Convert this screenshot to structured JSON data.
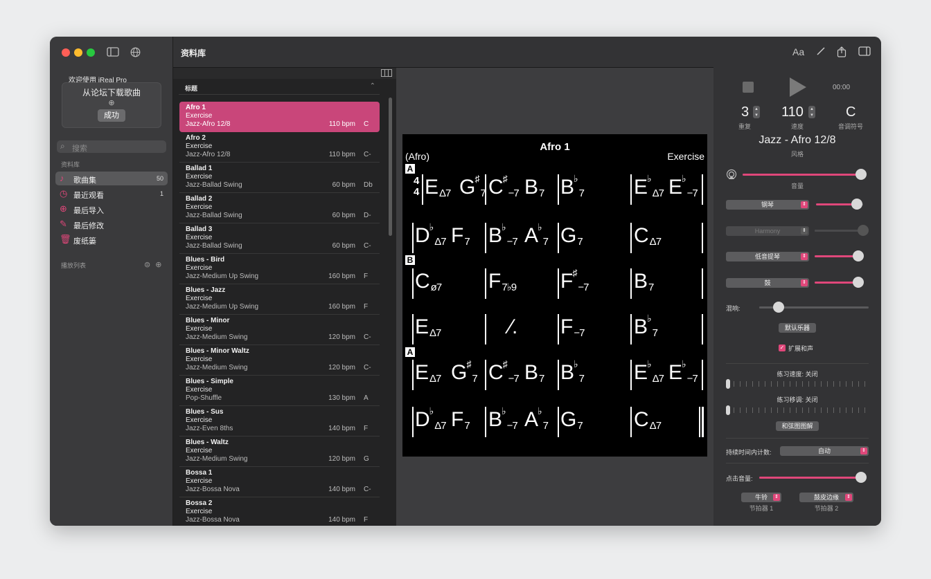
{
  "colors": {
    "accent": "#e0477a",
    "selected_row": "#c9467a",
    "red": "#fe5f57",
    "yellow": "#febc2e",
    "green": "#28c840"
  },
  "sidebar": {
    "welcome": "欢迎使用 iReal Pro",
    "forum_title": "从论坛下载歌曲",
    "forum_button": "成功",
    "search_placeholder": "搜索",
    "library_section": "资料库",
    "items": [
      {
        "icon": "music-note-icon",
        "label": "歌曲集",
        "count": "50"
      },
      {
        "icon": "clock-icon",
        "label": "最近观看",
        "count": "1"
      },
      {
        "icon": "download-icon",
        "label": "最后导入",
        "count": ""
      },
      {
        "icon": "edit-icon",
        "label": "最后修改",
        "count": ""
      },
      {
        "icon": "trash-icon",
        "label": "废纸篓",
        "count": ""
      }
    ],
    "playlist_section": "播放列表"
  },
  "list": {
    "header": "资料库",
    "column_title": "标题",
    "songs": [
      {
        "name": "Afro 1",
        "composer": "Exercise",
        "style": "Jazz-Afro 12/8",
        "bpm": "110 bpm",
        "key": "C"
      },
      {
        "name": "Afro 2",
        "composer": "Exercise",
        "style": "Jazz-Afro 12/8",
        "bpm": "110 bpm",
        "key": "C-"
      },
      {
        "name": "Ballad 1",
        "composer": "Exercise",
        "style": "Jazz-Ballad Swing",
        "bpm": "60 bpm",
        "key": "Db"
      },
      {
        "name": "Ballad 2",
        "composer": "Exercise",
        "style": "Jazz-Ballad Swing",
        "bpm": "60 bpm",
        "key": "D-"
      },
      {
        "name": "Ballad 3",
        "composer": "Exercise",
        "style": "Jazz-Ballad Swing",
        "bpm": "60 bpm",
        "key": "C-"
      },
      {
        "name": "Blues - Bird",
        "composer": "Exercise",
        "style": "Jazz-Medium Up Swing",
        "bpm": "160 bpm",
        "key": "F"
      },
      {
        "name": "Blues - Jazz",
        "composer": "Exercise",
        "style": "Jazz-Medium Up Swing",
        "bpm": "160 bpm",
        "key": "F"
      },
      {
        "name": "Blues - Minor",
        "composer": "Exercise",
        "style": "Jazz-Medium Swing",
        "bpm": "120 bpm",
        "key": "C-"
      },
      {
        "name": "Blues - Minor Waltz",
        "composer": "Exercise",
        "style": "Jazz-Medium Swing",
        "bpm": "120 bpm",
        "key": "C-"
      },
      {
        "name": "Blues - Simple",
        "composer": "Exercise",
        "style": "Pop-Shuffle",
        "bpm": "130 bpm",
        "key": "A"
      },
      {
        "name": "Blues - Sus",
        "composer": "Exercise",
        "style": "Jazz-Even 8ths",
        "bpm": "140 bpm",
        "key": "F"
      },
      {
        "name": "Blues - Waltz",
        "composer": "Exercise",
        "style": "Jazz-Medium Swing",
        "bpm": "120 bpm",
        "key": "G"
      },
      {
        "name": "Bossa 1",
        "composer": "Exercise",
        "style": "Jazz-Bossa Nova",
        "bpm": "140 bpm",
        "key": "C-"
      },
      {
        "name": "Bossa 2",
        "composer": "Exercise",
        "style": "Jazz-Bossa Nova",
        "bpm": "140 bpm",
        "key": "F"
      }
    ]
  },
  "sheet": {
    "title": "Afro 1",
    "style": "(Afro)",
    "composer": "Exercise",
    "section_a": "A",
    "section_b": "B",
    "time_top": "4",
    "time_bottom": "4"
  },
  "player": {
    "time": "00:00",
    "repeats": "3",
    "repeats_label": "重复",
    "tempo": "110",
    "tempo_label": "速度",
    "key": "C",
    "key_label": "音调符号",
    "style_name": "Jazz - Afro 12/8",
    "style_label": "风格",
    "volume_label": "音量",
    "instruments": [
      {
        "name": "钢琴",
        "level": 0.87
      },
      {
        "name": "Harmony",
        "level": 1.0
      },
      {
        "name": "低音提琴",
        "level": 0.9
      },
      {
        "name": "鼓",
        "level": 0.9
      }
    ],
    "master_volume": 0.98,
    "reverb_label": "混响:",
    "reverb_level": 0.18,
    "default_instruments": "默认乐器",
    "extended_harmony": "扩展和声",
    "practice_tempo": "练习速度: 关闭",
    "practice_transpose": "练习移调: 关闭",
    "chord_diagrams": "和弦图图解",
    "count_in_label": "持续时间内计数:",
    "count_in_value": "自动",
    "click_volume_label": "点击音量:",
    "click_volume": 0.98,
    "metronome1": "牛铃",
    "metronome1_label": "节拍器 1",
    "metronome2": "鼓皮边缘",
    "metronome2_label": "节拍器 2"
  }
}
